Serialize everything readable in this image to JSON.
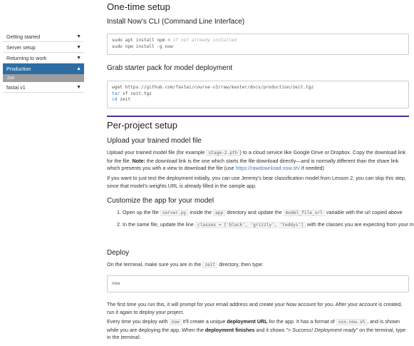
{
  "sidebar": {
    "items": [
      {
        "label": "Getting started",
        "arrow": "▼"
      },
      {
        "label": "Server setup",
        "arrow": "▼"
      },
      {
        "label": "Returning to work",
        "arrow": "▼"
      },
      {
        "label": "Production",
        "arrow": "▲"
      },
      {
        "label": "Zeit"
      },
      {
        "label": "fastai v1",
        "arrow": "▼"
      }
    ]
  },
  "content": {
    "h_onetime": "One-time setup",
    "h_install": "Install Now's CLI (Command Line Interface)",
    "code1_l1_cmd": "sudo apt install npm",
    "code1_l1_cmt": " # if not already installed",
    "code1_l2": "sudo npm install -g now",
    "h_starter": "Grab starter pack for model deployment",
    "code2_l1": "wget https://github.com/fastai/course-v3/raw/master/docs/production/zeit.tgz",
    "code2_l2_kw": "tar",
    "code2_l2_rest": " xf zeit.tgz",
    "code2_l3_kw": "cd",
    "code2_l3_rest": " zeit",
    "h_perproject": "Per-project setup",
    "h_upload": "Upload your trained model file",
    "p_upload_a": "Upload your trained model file (for example ",
    "p_upload_code": "stage-2.pth",
    "p_upload_b": ") to a cloud service like Google Drive or Dropbox. Copy the download link for the file. ",
    "p_upload_note": "Note:",
    "p_upload_c": " the download link is the one which starts the file download directly—and is normally different than the share link which presents you with a view to download the file (use ",
    "p_upload_link": "https://rawdownload.now.sh/",
    "p_upload_d": " if needed)",
    "p_test": "If you want to just test the deployment initially, you can use Jeremy's bear classification model from Lesson 2, you can skip this step, since that model's weights URL is already filled in the sample app.",
    "h_customize": "Customize the app for your model",
    "li1_a": "Open up the file ",
    "li1_code1": "server.py",
    "li1_b": " inside the ",
    "li1_code2": "app",
    "li1_c": " directory and update the ",
    "li1_code3": "model_file_url",
    "li1_d": " variable with the url copied above",
    "li2_a": "In the same file, update the line ",
    "li2_code": "classes = ['black', 'grizzly', 'teddys']",
    "li2_b": " with the classes you are expecting from your model",
    "h_deploy": "Deploy",
    "p_deploy_a": "On the terminal, make sure you are in the ",
    "p_deploy_code": "zeit",
    "p_deploy_b": " directory, then type:",
    "code3": "now",
    "p_first": "The first time you run this, it will prompt for your email address and create your Now account for you. After your account is created, run it again to deploy your project.",
    "p_every_a": "Every time you deploy with ",
    "p_every_code1": "now",
    "p_every_b": " it'll create a unique ",
    "p_every_bold1": "deployment URL",
    "p_every_c": " for the app. It has a format of ",
    "p_every_code2": "xxx.now.sh",
    "p_every_d": ", and is shown while you are deploying the app. When the ",
    "p_every_bold2": "deployment finishes",
    "p_every_e": " and it shows ",
    "p_every_em": "\"> Success! Deployment ready\"",
    "p_every_f": " on the terminal, type in the terminal:"
  }
}
